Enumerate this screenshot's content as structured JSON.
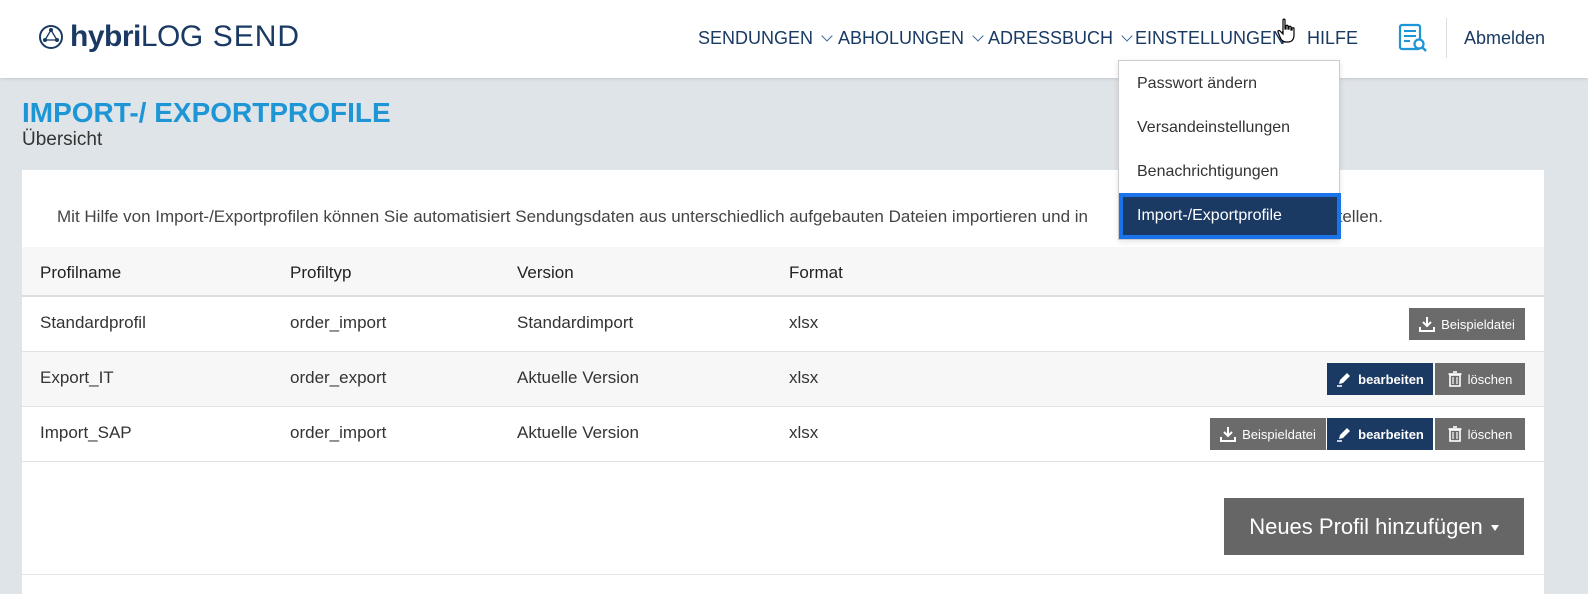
{
  "brand": {
    "hybri": "hybri",
    "log": "LOG",
    "send": "SEND"
  },
  "nav": {
    "items": [
      {
        "label": "SENDUNGEN",
        "has_chevron": true
      },
      {
        "label": "ABHOLUNGEN",
        "has_chevron": true
      },
      {
        "label": "ADRESSBUCH",
        "has_chevron": true
      },
      {
        "label": "EINSTELLUNGEN",
        "has_chevron": false
      },
      {
        "label": "HILFE",
        "has_chevron": false
      }
    ],
    "logout": "Abmelden"
  },
  "dropdown": {
    "items": [
      "Passwort ändern",
      "Versandeinstellungen",
      "Benachrichtigungen"
    ],
    "active": "Import-/Exportprofile"
  },
  "page": {
    "title": "IMPORT-/ EXPORTPROFILE",
    "subtitle": "Übersicht",
    "intro": "Mit Hilfe von Import-/Exportprofilen können Sie automatisiert Sendungsdaten aus unterschiedlich aufgebauten Dateien importieren und in",
    "intro_tail": "erstellen."
  },
  "table": {
    "headers": [
      "Profilname",
      "Profiltyp",
      "Version",
      "Format"
    ],
    "rows": [
      {
        "name": "Standardprofil",
        "type": "order_import",
        "version": "Standardimport",
        "format": "xlsx"
      },
      {
        "name": "Export_IT",
        "type": "order_export",
        "version": "Aktuelle Version",
        "format": "xlsx"
      },
      {
        "name": "Import_SAP",
        "type": "order_import",
        "version": "Aktuelle Version",
        "format": "xlsx"
      }
    ]
  },
  "buttons": {
    "sample": "Beispieldatei",
    "edit": "bearbeiten",
    "delete": "löschen",
    "add_profile": "Neues Profil hinzufügen"
  },
  "colors": {
    "navy": "#1a3a63",
    "accent": "#1e96d6",
    "grey_button": "#6b6b6b",
    "focus": "#1a73e8"
  }
}
